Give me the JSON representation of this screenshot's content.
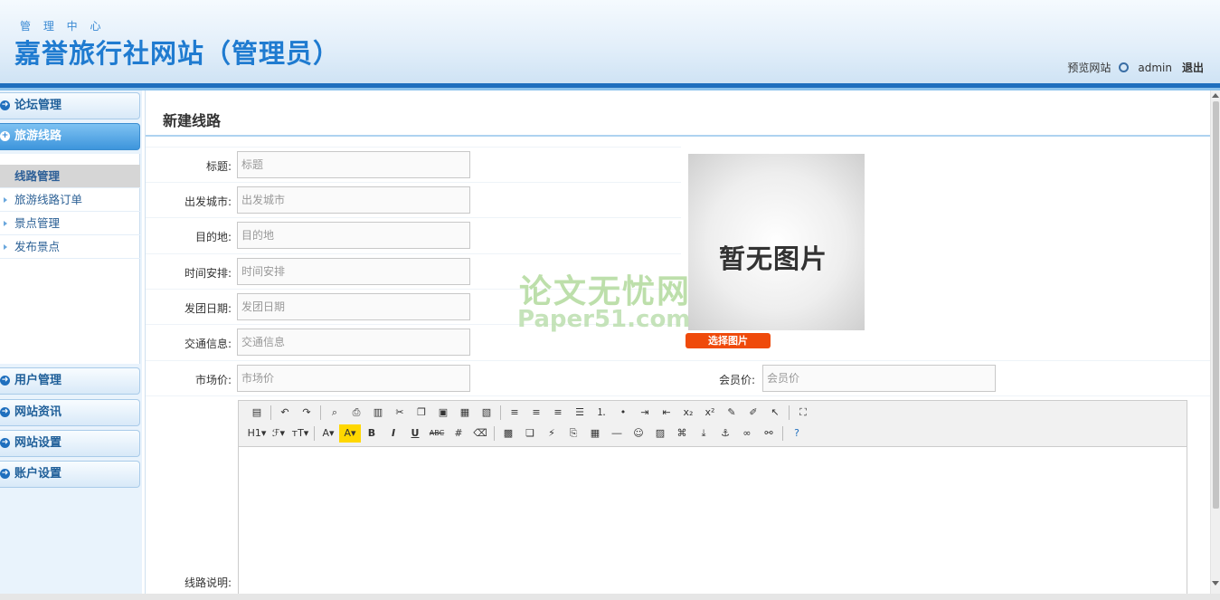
{
  "header": {
    "subtitle": "管 理 中 心",
    "title": "嘉誉旅行社网站（管理员）",
    "preview_link": "预览网站",
    "username": "admin",
    "logout": "退出"
  },
  "sidebar": {
    "groups": [
      {
        "label": "论坛管理"
      },
      {
        "label": "旅游线路",
        "active": true
      },
      {
        "label": "用户管理"
      },
      {
        "label": "网站资讯"
      },
      {
        "label": "网站设置"
      },
      {
        "label": "账户设置"
      }
    ],
    "sub_items": [
      {
        "label": "线路管理",
        "active": true
      },
      {
        "label": "旅游线路订单"
      },
      {
        "label": "景点管理"
      },
      {
        "label": "发布景点"
      }
    ]
  },
  "form": {
    "page_title": "新建线路",
    "fields": [
      {
        "label": "标题:",
        "placeholder": "标题"
      },
      {
        "label": "出发城市:",
        "placeholder": "出发城市"
      },
      {
        "label": "目的地:",
        "placeholder": "目的地"
      },
      {
        "label": "时间安排:",
        "placeholder": "时间安排"
      },
      {
        "label": "发团日期:",
        "placeholder": "发团日期"
      },
      {
        "label": "交通信息:",
        "placeholder": "交通信息"
      },
      {
        "label": "市场价:",
        "placeholder": "市场价"
      }
    ],
    "member_price": {
      "label": "会员价:",
      "placeholder": "会员价"
    },
    "image_placeholder": "暂无图片",
    "choose_image": "选择图片",
    "description_label": "线路说明:"
  },
  "watermark": {
    "line1": "论文无忧网",
    "line2": "Paper51.com"
  },
  "editor": {
    "toolbar_row1": [
      "source-icon",
      "undo-icon",
      "redo-icon",
      "preview-icon",
      "print-icon",
      "template-icon",
      "cut-icon",
      "copy-icon",
      "paste-icon",
      "paste-text-icon",
      "paste-word-icon",
      "align-left-icon",
      "align-center-icon",
      "align-right-icon",
      "justify-icon",
      "ordered-list-icon",
      "unordered-list-icon",
      "indent-icon",
      "outdent-icon",
      "subscript-icon",
      "superscript-icon",
      "clear-format-icon",
      "select-all-icon",
      "select-icon",
      "fullscreen-icon"
    ],
    "toolbar_row2_labels": [
      "H1▾",
      "ℱ▾",
      "тT▾",
      "A▾",
      "A▾",
      "B",
      "I",
      "U",
      "ABC",
      "#",
      "⌫"
    ],
    "toolbar_row2_icons": [
      "image-icon",
      "multi-image-icon",
      "flash-icon",
      "media-icon",
      "attachment-icon",
      "table-icon",
      "hr-icon",
      "emoticon-icon",
      "map-icon",
      "code-icon",
      "page-break-icon",
      "anchor-icon",
      "link-icon",
      "unlink-icon",
      "help-icon"
    ]
  }
}
